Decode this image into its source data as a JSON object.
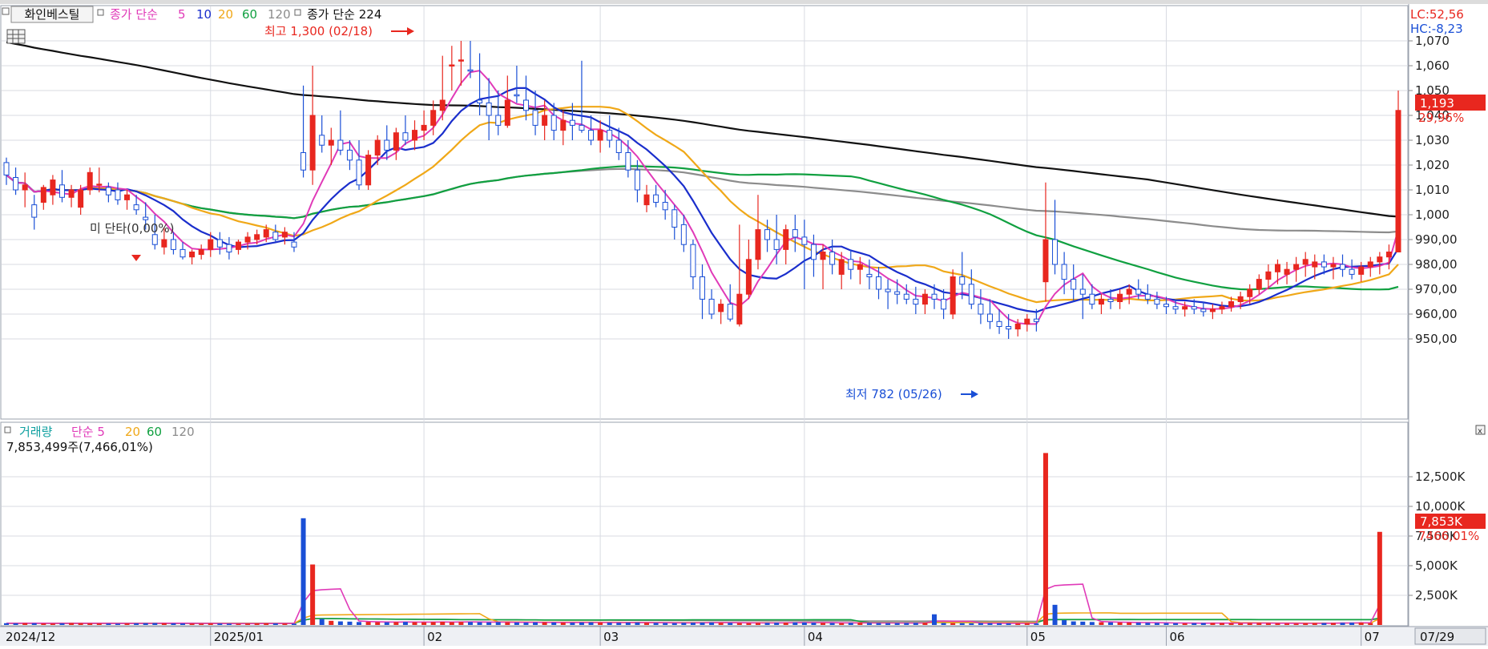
{
  "price_panel": {
    "button": "화인베스틸",
    "legend": [
      {
        "text": "종가 단순",
        "color": "#e03ab8"
      },
      {
        "text": "5",
        "color": "#e03ab8"
      },
      {
        "text": "10",
        "color": "#1a2ecc"
      },
      {
        "text": "20",
        "color": "#f0a818"
      },
      {
        "text": "60",
        "color": "#10a040"
      },
      {
        "text": "120",
        "color": "#8c8c8c"
      }
    ],
    "legend2": "종가 단순 224",
    "lc": "LC:52,56",
    "hc": "HC:-8,23",
    "high_annotation": "최고 1,300 (02/18)",
    "low_annotation": "최저 782 (05/26)",
    "cursor_label": "미 단타(0,00%)",
    "last_price": "1,193",
    "last_change": "29,96%"
  },
  "volume_panel": {
    "legend": [
      {
        "text": "거래량",
        "color": "#10a0a0"
      },
      {
        "text": "단순 5",
        "color": "#e03ab8"
      },
      {
        "text": "20",
        "color": "#f0a818"
      },
      {
        "text": "60",
        "color": "#10a040"
      },
      {
        "text": "120",
        "color": "#8c8c8c"
      }
    ],
    "info": "7,853,499주(7,466,01%)",
    "last_volume": "7,853K",
    "last_volume_pct": "7466,01%"
  },
  "x_axis_labels": [
    "2024/12",
    "2025/01",
    "02",
    "03",
    "04",
    "05",
    "06",
    "07"
  ],
  "date_box": "07/29",
  "colors": {
    "up": "#e8271f",
    "down": "#1a4fd6",
    "ma224": "#111111"
  },
  "chart_data": [
    {
      "type": "candlestick",
      "title": "화인베스틸",
      "y_ticks": [
        "1,070",
        "1,060",
        "1,050",
        "1,040",
        "1,030",
        "1,020",
        "1,010",
        "1,000",
        "990,00",
        "980,00",
        "970,00",
        "960,00",
        "950,00"
      ],
      "ylim_scale": [
        947,
        1075
      ],
      "ohlc": [
        [
          1021,
          1023,
          1012,
          1016
        ],
        [
          1015,
          1019,
          1008,
          1010
        ],
        [
          1010,
          1017,
          1003,
          1012
        ],
        [
          1004,
          1008,
          994,
          999
        ],
        [
          1005,
          1012,
          1002,
          1011
        ],
        [
          1008,
          1016,
          1004,
          1014
        ],
        [
          1012,
          1018,
          1005,
          1007
        ],
        [
          1007,
          1012,
          1003,
          1010
        ],
        [
          1003,
          1012,
          1000,
          1010
        ],
        [
          1010,
          1019,
          1008,
          1017
        ],
        [
          1012,
          1019,
          1009,
          1012
        ],
        [
          1011,
          1013,
          1005,
          1008
        ],
        [
          1010,
          1013,
          1004,
          1006
        ],
        [
          1006,
          1010,
          1002,
          1008
        ],
        [
          1004,
          1008,
          1000,
          1002
        ],
        [
          999,
          1005,
          994,
          998
        ],
        [
          992,
          1000,
          986,
          988
        ],
        [
          987,
          995,
          984,
          990
        ],
        [
          990,
          993,
          984,
          986
        ],
        [
          986,
          989,
          982,
          983
        ],
        [
          983,
          986,
          980,
          985
        ],
        [
          984,
          988,
          982,
          986
        ],
        [
          986,
          993,
          983,
          990
        ],
        [
          990,
          993,
          984,
          987
        ],
        [
          988,
          991,
          982,
          985
        ],
        [
          986,
          990,
          984,
          989
        ],
        [
          989,
          993,
          986,
          991
        ],
        [
          990,
          994,
          988,
          992
        ],
        [
          991,
          996,
          989,
          994
        ],
        [
          993,
          996,
          989,
          990
        ],
        [
          991,
          995,
          988,
          993
        ],
        [
          989,
          993,
          985,
          987
        ],
        [
          1025,
          1052,
          1015,
          1018
        ],
        [
          1018,
          1060,
          1012,
          1040
        ],
        [
          1032,
          1040,
          1025,
          1028
        ],
        [
          1028,
          1035,
          1020,
          1030
        ],
        [
          1030,
          1042,
          1024,
          1026
        ],
        [
          1026,
          1030,
          1018,
          1022
        ],
        [
          1022,
          1030,
          1010,
          1012
        ],
        [
          1012,
          1026,
          1010,
          1024
        ],
        [
          1024,
          1032,
          1020,
          1030
        ],
        [
          1030,
          1036,
          1022,
          1026
        ],
        [
          1026,
          1035,
          1022,
          1033
        ],
        [
          1033,
          1040,
          1028,
          1030
        ],
        [
          1030,
          1038,
          1026,
          1034
        ],
        [
          1034,
          1042,
          1030,
          1036
        ],
        [
          1036,
          1046,
          1032,
          1042
        ],
        [
          1042,
          1064,
          1038,
          1060
        ],
        [
          1060,
          1068,
          1050,
          1062
        ],
        [
          1062,
          1070,
          1052,
          1065
        ],
        [
          1065,
          1070,
          1055,
          1058
        ],
        [
          1058,
          1065,
          1040,
          1045
        ],
        [
          1045,
          1055,
          1030,
          1040
        ],
        [
          1040,
          1050,
          1032,
          1036
        ],
        [
          1036,
          1056,
          1035,
          1054
        ],
        [
          1054,
          1060,
          1045,
          1048
        ],
        [
          1048,
          1056,
          1038,
          1042
        ],
        [
          1042,
          1050,
          1032,
          1036
        ],
        [
          1036,
          1046,
          1030,
          1040
        ],
        [
          1040,
          1045,
          1030,
          1034
        ],
        [
          1034,
          1042,
          1028,
          1038
        ],
        [
          1038,
          1045,
          1030,
          1036
        ],
        [
          1036,
          1062,
          1033,
          1034
        ],
        [
          1034,
          1040,
          1028,
          1030
        ],
        [
          1030,
          1038,
          1025,
          1034
        ],
        [
          1034,
          1040,
          1027,
          1030
        ],
        [
          1030,
          1035,
          1022,
          1025
        ],
        [
          1025,
          1030,
          1015,
          1018
        ],
        [
          1018,
          1022,
          1005,
          1010
        ],
        [
          1004,
          1012,
          1001,
          1008
        ],
        [
          1008,
          1012,
          1003,
          1005
        ],
        [
          1005,
          1010,
          998,
          1002
        ],
        [
          1002,
          1004,
          990,
          995
        ],
        [
          996,
          1000,
          985,
          988
        ],
        [
          988,
          990,
          970,
          975
        ],
        [
          975,
          980,
          958,
          966
        ],
        [
          966,
          970,
          958,
          960
        ],
        [
          961,
          966,
          956,
          964
        ],
        [
          964,
          972,
          957,
          958
        ],
        [
          956,
          996,
          955,
          968
        ],
        [
          968,
          990,
          966,
          982
        ],
        [
          982,
          1008,
          978,
          994
        ],
        [
          994,
          998,
          985,
          990
        ],
        [
          990,
          1000,
          980,
          986
        ],
        [
          986,
          996,
          980,
          994
        ],
        [
          994,
          1000,
          985,
          991
        ],
        [
          991,
          998,
          970,
          988
        ],
        [
          988,
          992,
          975,
          982
        ],
        [
          982,
          988,
          970,
          985
        ],
        [
          985,
          990,
          976,
          980
        ],
        [
          976,
          985,
          970,
          982
        ],
        [
          982,
          986,
          974,
          978
        ],
        [
          978,
          983,
          972,
          980
        ],
        [
          976,
          982,
          970,
          975
        ],
        [
          975,
          979,
          966,
          970
        ],
        [
          970,
          974,
          962,
          969
        ],
        [
          969,
          974,
          964,
          968
        ],
        [
          968,
          972,
          964,
          966
        ],
        [
          966,
          971,
          960,
          964
        ],
        [
          964,
          970,
          960,
          968
        ],
        [
          968,
          972,
          962,
          966
        ],
        [
          966,
          970,
          958,
          962
        ],
        [
          960,
          978,
          958,
          975
        ],
        [
          975,
          985,
          966,
          972
        ],
        [
          972,
          978,
          962,
          964
        ],
        [
          964,
          970,
          956,
          960
        ],
        [
          960,
          966,
          954,
          957
        ],
        [
          957,
          962,
          952,
          955
        ],
        [
          955,
          960,
          950,
          954
        ],
        [
          954,
          958,
          951,
          956
        ],
        [
          956,
          960,
          953,
          958
        ],
        [
          958,
          962,
          953,
          957
        ],
        [
          973,
          1013,
          965,
          990
        ],
        [
          990,
          1006,
          976,
          980
        ],
        [
          980,
          985,
          968,
          974
        ],
        [
          974,
          980,
          965,
          970
        ],
        [
          970,
          976,
          958,
          968
        ],
        [
          968,
          972,
          962,
          964
        ],
        [
          964,
          968,
          960,
          966
        ],
        [
          966,
          970,
          962,
          965
        ],
        [
          965,
          970,
          962,
          968
        ],
        [
          968,
          972,
          964,
          970
        ],
        [
          970,
          974,
          966,
          968
        ],
        [
          968,
          972,
          964,
          966
        ],
        [
          966,
          969,
          962,
          964
        ],
        [
          964,
          967,
          960,
          963
        ],
        [
          963,
          966,
          960,
          962
        ],
        [
          962,
          965,
          959,
          963
        ],
        [
          963,
          966,
          960,
          962
        ],
        [
          962,
          965,
          959,
          961
        ],
        [
          961,
          964,
          958,
          962
        ],
        [
          962,
          965,
          960,
          963
        ],
        [
          963,
          967,
          961,
          965
        ],
        [
          965,
          969,
          962,
          967
        ],
        [
          967,
          972,
          964,
          970
        ],
        [
          970,
          976,
          968,
          974
        ],
        [
          974,
          980,
          970,
          977
        ],
        [
          977,
          982,
          972,
          980
        ],
        [
          976,
          981,
          972,
          978
        ],
        [
          978,
          983,
          973,
          980
        ],
        [
          980,
          985,
          975,
          982
        ],
        [
          979,
          984,
          974,
          981
        ],
        [
          981,
          984,
          976,
          979
        ],
        [
          979,
          983,
          974,
          980
        ],
        [
          980,
          984,
          975,
          978
        ],
        [
          978,
          982,
          974,
          976
        ],
        [
          976,
          981,
          973,
          979
        ],
        [
          979,
          983,
          975,
          981
        ],
        [
          981,
          985,
          976,
          983
        ],
        [
          983,
          988,
          978,
          985
        ],
        [
          985,
          1050,
          985,
          1042
        ]
      ]
    },
    {
      "type": "bar",
      "title": "거래량",
      "y_ticks": [
        "12,500K",
        "10,000K",
        "7,500K",
        "5,000K",
        "2,500K"
      ],
      "ylim_k": [
        0,
        14500
      ],
      "volumes_k": [
        150,
        140,
        160,
        150,
        130,
        120,
        140,
        160,
        150,
        140,
        130,
        120,
        110,
        130,
        140,
        150,
        160,
        150,
        140,
        130,
        120,
        110,
        130,
        120,
        110,
        100,
        120,
        130,
        140,
        130,
        120,
        110,
        9000,
        5100,
        500,
        350,
        300,
        280,
        250,
        260,
        240,
        230,
        250,
        260,
        240,
        230,
        250,
        270,
        240,
        260,
        250,
        230,
        220,
        240,
        230,
        210,
        200,
        220,
        230,
        210,
        200,
        190,
        210,
        220,
        200,
        190,
        180,
        200,
        210,
        190,
        180,
        170,
        160,
        180,
        190,
        200,
        210,
        190,
        180,
        170,
        160,
        170,
        180,
        190,
        200,
        220,
        210,
        190,
        180,
        170,
        160,
        180,
        190,
        170,
        160,
        150,
        160,
        170,
        180,
        190,
        900,
        170,
        160,
        150,
        140,
        160,
        150,
        140,
        130,
        120,
        140,
        130,
        14500,
        1700,
        400,
        300,
        280,
        250,
        230,
        220,
        210,
        200,
        190,
        180,
        170,
        160,
        150,
        140,
        150,
        160,
        170,
        160,
        150,
        140,
        160,
        170,
        150,
        140,
        130,
        120,
        140,
        150,
        160,
        170,
        180,
        190,
        200,
        160,
        7853
      ]
    }
  ]
}
